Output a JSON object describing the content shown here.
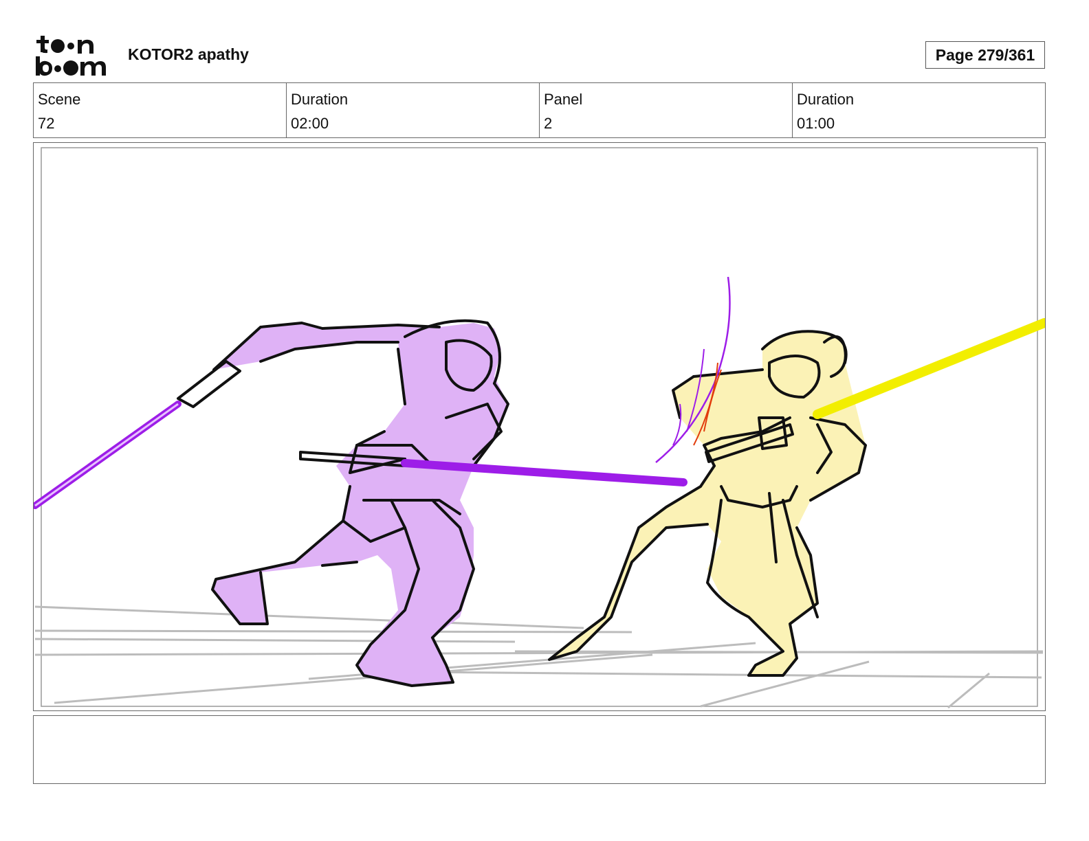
{
  "header": {
    "logo_text_top": "toon",
    "logo_text_bottom": "boom",
    "project_title": "KOTOR2 apathy",
    "page_label": "Page 279/361"
  },
  "info": {
    "scene_label": "Scene",
    "scene_value": "72",
    "scene_duration_label": "Duration",
    "scene_duration_value": "02:00",
    "panel_label": "Panel",
    "panel_value": "2",
    "panel_duration_label": "Duration",
    "panel_duration_value": "01:00"
  },
  "colors": {
    "purple_fill": "#dfb2f6",
    "purple_saber": "#9d1de8",
    "yellow_fill": "#fbf2b6",
    "yellow_saber": "#f2ee00",
    "ground_lines": "#bcbcbc",
    "ink": "#111111"
  },
  "notes": {
    "text": ""
  }
}
